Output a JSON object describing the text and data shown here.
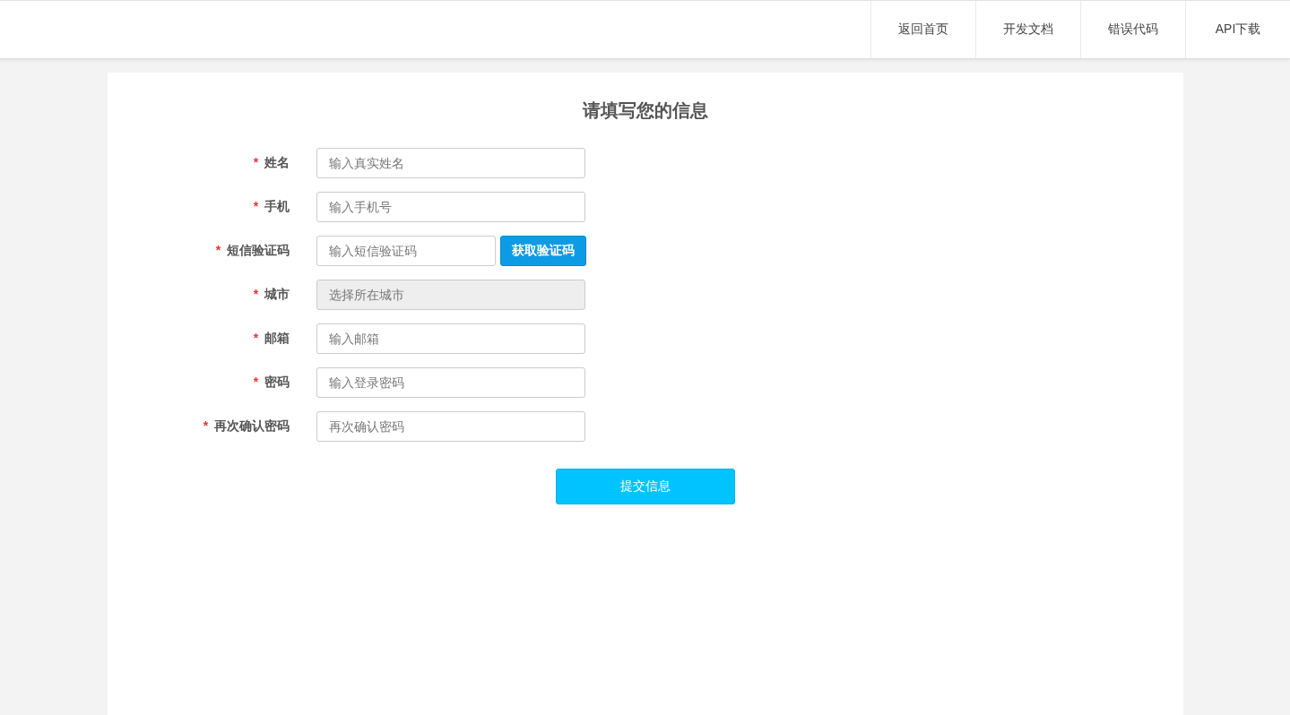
{
  "nav": [
    {
      "label": "返回首页"
    },
    {
      "label": "开发文档"
    },
    {
      "label": "错误代码"
    },
    {
      "label": "API下载"
    }
  ],
  "form": {
    "title": "请填写您的信息",
    "fields": [
      {
        "kind": "text",
        "required_mark": "*",
        "label": "姓名",
        "placeholder": "输入真实姓名",
        "disabled": false
      },
      {
        "kind": "text",
        "required_mark": "*",
        "label": "手机",
        "placeholder": "输入手机号",
        "disabled": false
      },
      {
        "kind": "sms",
        "required_mark": "*",
        "label": "短信验证码",
        "placeholder": "输入短信验证码",
        "disabled": false,
        "button": "获取验证码"
      },
      {
        "kind": "text",
        "required_mark": "*",
        "label": "城市",
        "placeholder": "选择所在城市",
        "disabled": true
      },
      {
        "kind": "text",
        "required_mark": "*",
        "label": "邮箱",
        "placeholder": "输入邮箱",
        "disabled": false
      },
      {
        "kind": "password",
        "required_mark": "*",
        "label": "密码",
        "placeholder": "输入登录密码",
        "disabled": false
      },
      {
        "kind": "password",
        "required_mark": "*",
        "label": "再次确认密码",
        "placeholder": "再次确认密码",
        "disabled": false
      }
    ],
    "submit": "提交信息"
  }
}
